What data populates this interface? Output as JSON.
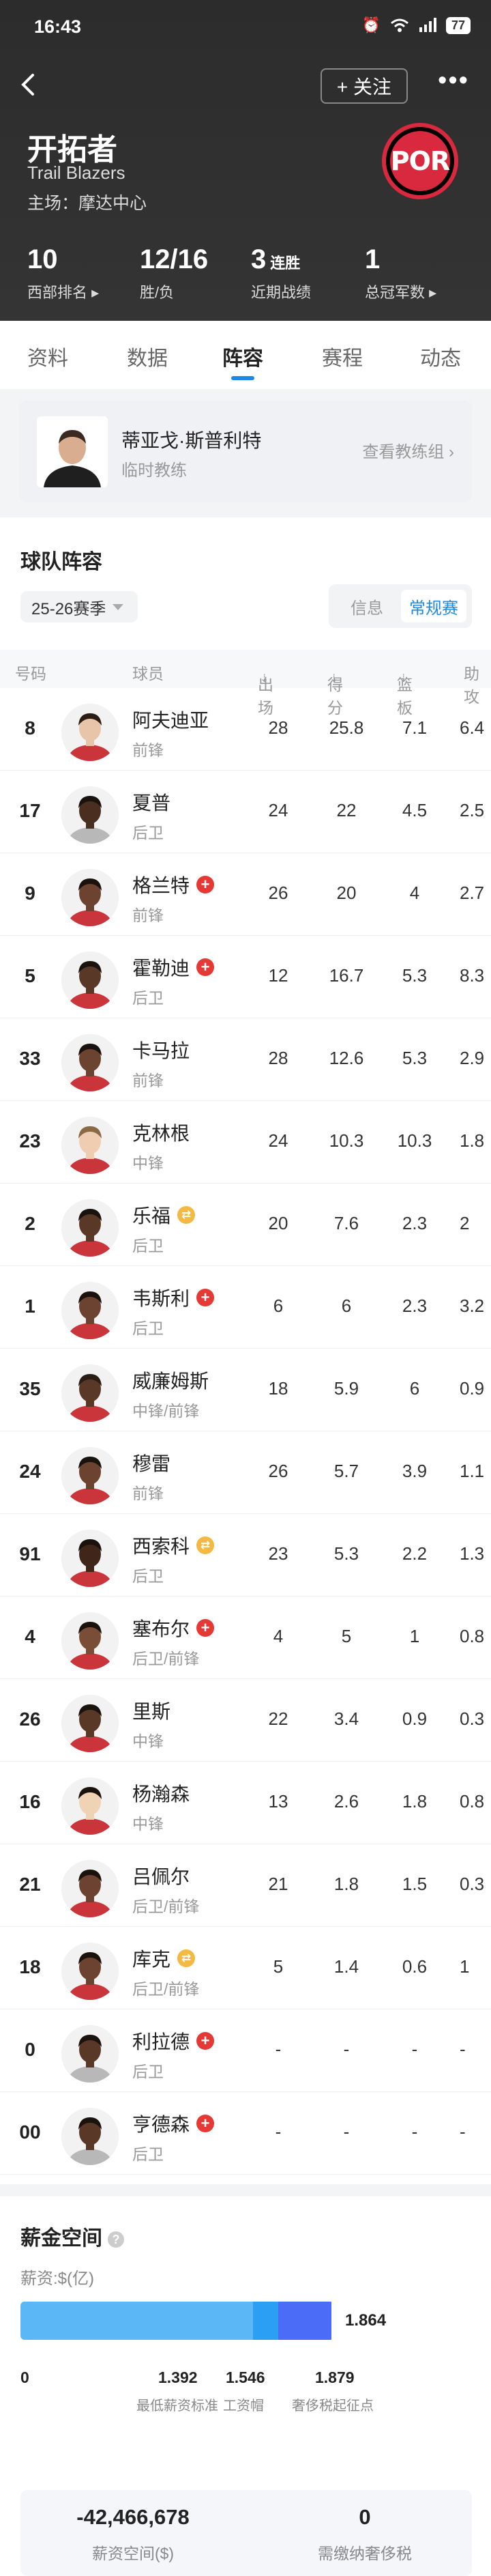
{
  "status_bar": {
    "time": "16:43",
    "battery": "77"
  },
  "header": {
    "follow_label": "+ 关注",
    "team_name": "开拓者",
    "team_en": "Trail Blazers",
    "home": "主场：摩达中心",
    "logo_text": "POR",
    "stats": [
      {
        "value": "10",
        "suffix": "",
        "label": "西部排名 ▸"
      },
      {
        "value": "12/16",
        "suffix": "",
        "label": "胜/负"
      },
      {
        "value": "3",
        "suffix": "连胜",
        "label": "近期战绩"
      },
      {
        "value": "1",
        "suffix": "",
        "label": "总冠军数 ▸"
      }
    ]
  },
  "tabs": [
    "资料",
    "数据",
    "阵容",
    "赛程",
    "动态"
  ],
  "active_tab": "阵容",
  "coach": {
    "name": "蒂亚戈·斯普利特",
    "role": "临时教练",
    "link": "查看教练组 ›"
  },
  "roster": {
    "title": "球队阵容",
    "season": "25-26赛季",
    "toggle": [
      "信息",
      "常规赛"
    ],
    "headers": {
      "number": "号码",
      "player": "球员",
      "games": "出场",
      "points": "得分",
      "rebounds": "篮板",
      "assists": "助攻"
    },
    "players": [
      {
        "number": "8",
        "name": "阿夫迪亚",
        "pos": "前锋",
        "badge": "",
        "g": "28",
        "pts": "25.8",
        "reb": "7.1",
        "ast": "6.4",
        "skin": "#e8c4a8",
        "hair": "#2a1d14",
        "jersey": "#c9353b"
      },
      {
        "number": "17",
        "name": "夏普",
        "pos": "后卫",
        "badge": "",
        "g": "24",
        "pts": "22",
        "reb": "4.5",
        "ast": "2.5",
        "skin": "#4a2e20",
        "hair": "#1a120c",
        "jersey": "#b8b8b8"
      },
      {
        "number": "9",
        "name": "格兰特",
        "pos": "前锋",
        "badge": "inj",
        "g": "26",
        "pts": "20",
        "reb": "4",
        "ast": "2.7",
        "skin": "#6b4330",
        "hair": "#1a120c",
        "jersey": "#c9353b"
      },
      {
        "number": "5",
        "name": "霍勒迪",
        "pos": "后卫",
        "badge": "inj",
        "g": "12",
        "pts": "16.7",
        "reb": "5.3",
        "ast": "8.3",
        "skin": "#5a3828",
        "hair": "#1a120c",
        "jersey": "#c9353b"
      },
      {
        "number": "33",
        "name": "卡马拉",
        "pos": "前锋",
        "badge": "",
        "g": "28",
        "pts": "12.6",
        "reb": "5.3",
        "ast": "2.9",
        "skin": "#6b4330",
        "hair": "#1a120c",
        "jersey": "#c9353b"
      },
      {
        "number": "23",
        "name": "克林根",
        "pos": "中锋",
        "badge": "",
        "g": "24",
        "pts": "10.3",
        "reb": "10.3",
        "ast": "1.8",
        "skin": "#f0cdb0",
        "hair": "#8a6a45",
        "jersey": "#c9353b"
      },
      {
        "number": "2",
        "name": "乐福",
        "pos": "后卫",
        "badge": "rest",
        "g": "20",
        "pts": "7.6",
        "reb": "2.3",
        "ast": "2",
        "skin": "#5a3828",
        "hair": "#1a120c",
        "jersey": "#c9353b"
      },
      {
        "number": "1",
        "name": "韦斯利",
        "pos": "后卫",
        "badge": "inj",
        "g": "6",
        "pts": "6",
        "reb": "2.3",
        "ast": "3.2",
        "skin": "#6b4330",
        "hair": "#1a120c",
        "jersey": "#c9353b"
      },
      {
        "number": "35",
        "name": "威廉姆斯",
        "pos": "中锋/前锋",
        "badge": "",
        "g": "18",
        "pts": "5.9",
        "reb": "6",
        "ast": "0.9",
        "skin": "#5a3828",
        "hair": "#2a1d14",
        "jersey": "#c9353b"
      },
      {
        "number": "24",
        "name": "穆雷",
        "pos": "前锋",
        "badge": "",
        "g": "26",
        "pts": "5.7",
        "reb": "3.9",
        "ast": "1.1",
        "skin": "#6b4330",
        "hair": "#1a120c",
        "jersey": "#c9353b"
      },
      {
        "number": "91",
        "name": "西索科",
        "pos": "后卫",
        "badge": "rest",
        "g": "23",
        "pts": "5.3",
        "reb": "2.2",
        "ast": "1.3",
        "skin": "#3f2619",
        "hair": "#1a120c",
        "jersey": "#c9353b"
      },
      {
        "number": "4",
        "name": "塞布尔",
        "pos": "后卫/前锋",
        "badge": "inj",
        "g": "4",
        "pts": "5",
        "reb": "1",
        "ast": "0.8",
        "skin": "#7a4d36",
        "hair": "#1a120c",
        "jersey": "#c9353b"
      },
      {
        "number": "26",
        "name": "里斯",
        "pos": "中锋",
        "badge": "",
        "g": "22",
        "pts": "3.4",
        "reb": "0.9",
        "ast": "0.3",
        "skin": "#5a3828",
        "hair": "#1a120c",
        "jersey": "#c9353b"
      },
      {
        "number": "16",
        "name": "杨瀚森",
        "pos": "中锋",
        "badge": "",
        "g": "13",
        "pts": "2.6",
        "reb": "1.8",
        "ast": "0.8",
        "skin": "#f0d2b5",
        "hair": "#1a120c",
        "jersey": "#c9353b"
      },
      {
        "number": "21",
        "name": "吕佩尔",
        "pos": "后卫/前锋",
        "badge": "",
        "g": "21",
        "pts": "1.8",
        "reb": "1.5",
        "ast": "0.3",
        "skin": "#6b4330",
        "hair": "#1a120c",
        "jersey": "#c9353b"
      },
      {
        "number": "18",
        "name": "库克",
        "pos": "后卫/前锋",
        "badge": "rest",
        "g": "5",
        "pts": "1.4",
        "reb": "0.6",
        "ast": "1",
        "skin": "#6b4330",
        "hair": "#1a120c",
        "jersey": "#c9353b"
      },
      {
        "number": "0",
        "name": "利拉德",
        "pos": "后卫",
        "badge": "inj",
        "g": "-",
        "pts": "-",
        "reb": "-",
        "ast": "-",
        "skin": "#5a3828",
        "hair": "#1a120c",
        "jersey": "#b8b8b8"
      },
      {
        "number": "00",
        "name": "亨德森",
        "pos": "后卫",
        "badge": "inj",
        "g": "-",
        "pts": "-",
        "reb": "-",
        "ast": "-",
        "skin": "#5a3828",
        "hair": "#1a120c",
        "jersey": "#b8b8b8"
      }
    ]
  },
  "salary": {
    "title": "薪金空间",
    "help": "?",
    "unit_label": "薪资:$(亿)",
    "current": 1.864,
    "scale_max": 1.879,
    "current_label": "1.864",
    "segments": [
      {
        "value": 1.392,
        "color": "#5bb7f6"
      },
      {
        "value": 1.546,
        "color": "#2b9ff2"
      },
      {
        "value": 1.864,
        "color": "#4a6cf7"
      }
    ],
    "ticks": [
      {
        "value": "0",
        "label": ""
      },
      {
        "value": "1.392",
        "label": "最低薪资标准"
      },
      {
        "value": "1.546",
        "label": "工资帽"
      },
      {
        "value": "1.879",
        "label": "奢侈税起征点"
      }
    ],
    "space_value": "-42,466,678",
    "space_label": "薪资空间($)",
    "tax_value": "0",
    "tax_label": "需缴纳奢侈税"
  },
  "colors": {
    "accent": "#1e88e5",
    "injury": "#e53935",
    "rest": "#f4b942",
    "header_bg": "#2f2f2f"
  }
}
